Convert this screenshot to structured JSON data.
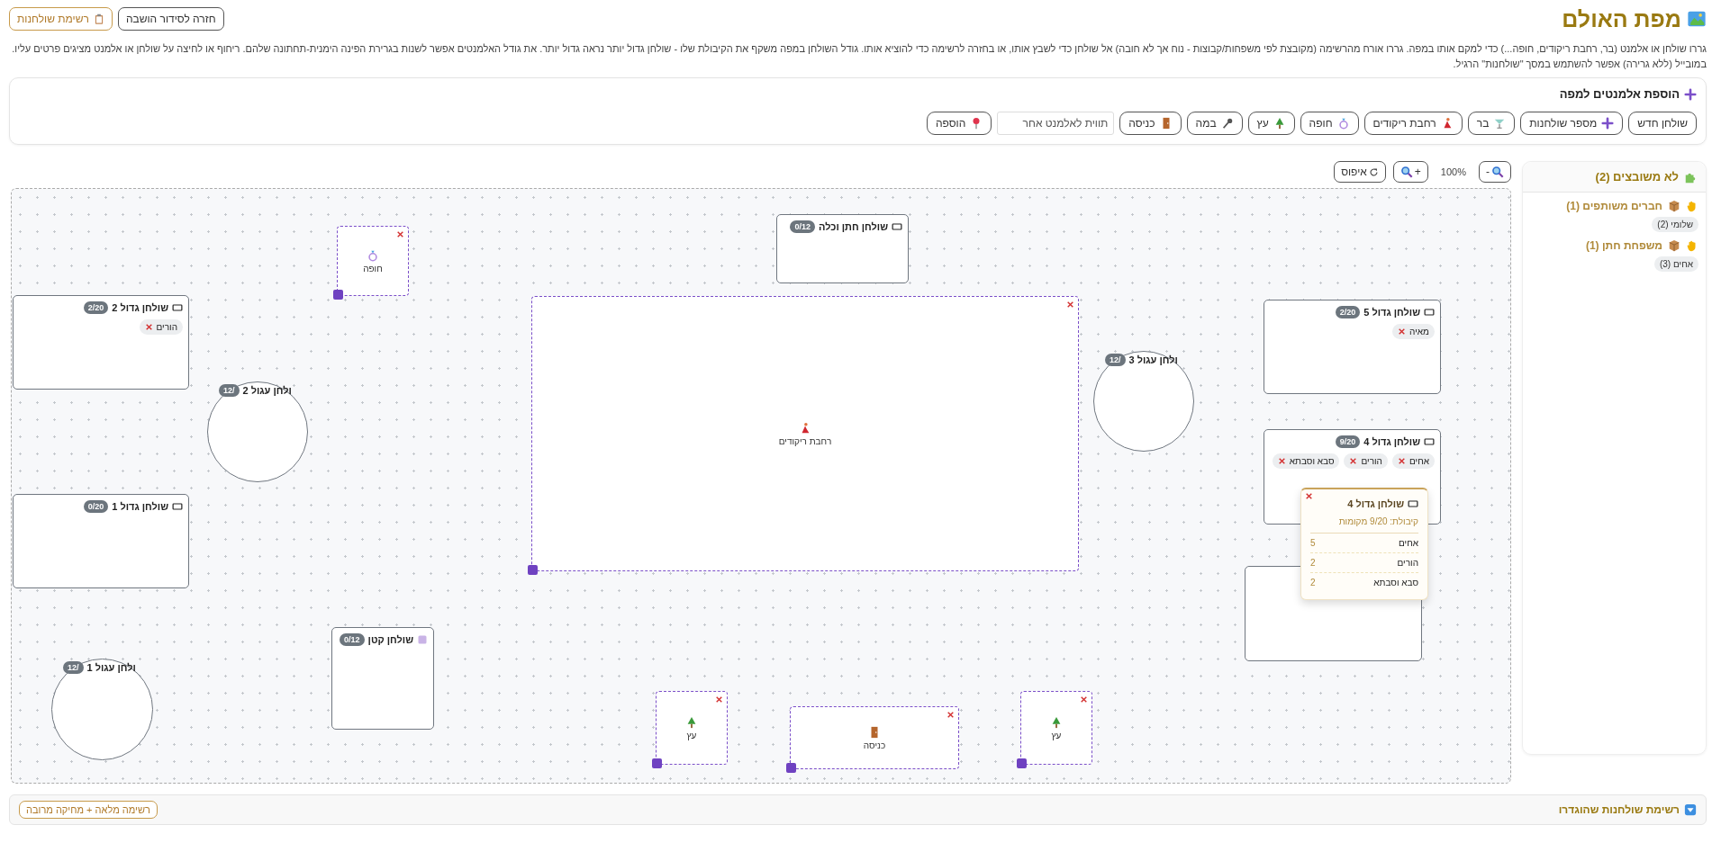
{
  "header": {
    "title": "מפת האולם",
    "buttons": [
      {
        "label": "חזרה לסידור הושבה",
        "kind": "plain"
      },
      {
        "label": "רשימת שולחנות",
        "kind": "accent"
      }
    ]
  },
  "instructions": [
    "גררו שולחן או אלמנט (בר, רחבת ריקודים, חופה...) כדי למקם אותו במפה. גררו אורח מהרשימה (מקובצת לפי משפחות/קבוצות - נוח אך לא חובה) אל שולחן כדי לשבץ אותו, או בחזרה לרשימה כדי להוציא אותו. גודל השולחן במפה משקף את הקיבולת שלו - שולחן גדול יותר נראה גדול יותר. את גודל האלמנטים אפשר לשנות בגרירת הפינה הימנית-תחתונה שלהם. ריחוף או לחיצה על שולחן או אלמנט מציגים פרטים עליו.",
    "במובייל (ללא גרירה) אפשר להשתמש במסך \"שולחנות\" הרגיל."
  ],
  "add_panel": {
    "title": "הוספת אלמנטים למפה",
    "items": [
      {
        "kind": "button",
        "label": "שולחן חדש"
      },
      {
        "kind": "button",
        "label": "מספר שולחנות"
      },
      {
        "kind": "button",
        "label": "בר"
      },
      {
        "kind": "button",
        "label": "רחבת ריקודים"
      },
      {
        "kind": "button",
        "label": "חופה"
      },
      {
        "kind": "button",
        "label": "עץ"
      },
      {
        "kind": "button",
        "label": "במה"
      },
      {
        "kind": "button",
        "label": "כניסה"
      },
      {
        "kind": "input",
        "placeholder": "תווית לאלמנט אחר"
      },
      {
        "kind": "button",
        "label": "הוספה"
      }
    ]
  },
  "zoom": {
    "zoom_out": "-",
    "percent": "100%",
    "zoom_in": "+",
    "reset": "איפוס"
  },
  "canvas": {
    "items": [
      {
        "kind": "element",
        "label": "חופה"
      },
      {
        "kind": "rect_table",
        "title": "שולחן חתן וכלה",
        "count": "0/12"
      },
      {
        "kind": "rect_table",
        "title": "שולחן גדול 2",
        "count": "2/20",
        "guests": [
          "הורים"
        ]
      },
      {
        "kind": "round_table",
        "title": "ולחן עגול 2",
        "count": "/12"
      },
      {
        "kind": "element",
        "label": "רחבת ריקודים"
      },
      {
        "kind": "round_table",
        "title": "ולחן עגול 3",
        "count": "/12"
      },
      {
        "kind": "rect_table",
        "title": "שולחן גדול 5",
        "count": "2/20",
        "guests": [
          "מאיה"
        ]
      },
      {
        "kind": "rect_table",
        "title": "שולחן גדול 4",
        "count": "9/20",
        "guests": [
          "אחים",
          "הורים",
          "סבא וסבתא"
        ]
      },
      {
        "kind": "rect_table",
        "title": "שולחן גדול 1",
        "count": "0/20"
      },
      {
        "kind": "rect_table"
      },
      {
        "kind": "square_table",
        "title": "שולחן קטן",
        "count": "0/12"
      },
      {
        "kind": "round_table",
        "title": "ולחן עגול 1",
        "count": "/12"
      },
      {
        "kind": "element",
        "label": "עץ"
      },
      {
        "kind": "element",
        "label": "כניסה"
      },
      {
        "kind": "element",
        "label": "עץ"
      }
    ],
    "popup": {
      "title": "שולחן גדול 4",
      "capacity": "קיבולת: 9/20 מקומות",
      "rows": [
        {
          "name": "אחים",
          "count": "5"
        },
        {
          "name": "הורים",
          "count": "2"
        },
        {
          "name": "סבא וסבתא",
          "count": "2"
        }
      ]
    }
  },
  "sidebar": {
    "title": "לא משובצים (2)",
    "groups": [
      {
        "title": "חברים משותפים (1)",
        "chips": [
          "שלומי (2)"
        ]
      },
      {
        "title": "משפחת חתן (1)",
        "chips": [
          "אחים (3)"
        ]
      }
    ]
  },
  "footer": {
    "title": "רשימת שולחנות שהוגדרו",
    "button": "רשימה מלאה + מחיקה מרובה"
  }
}
